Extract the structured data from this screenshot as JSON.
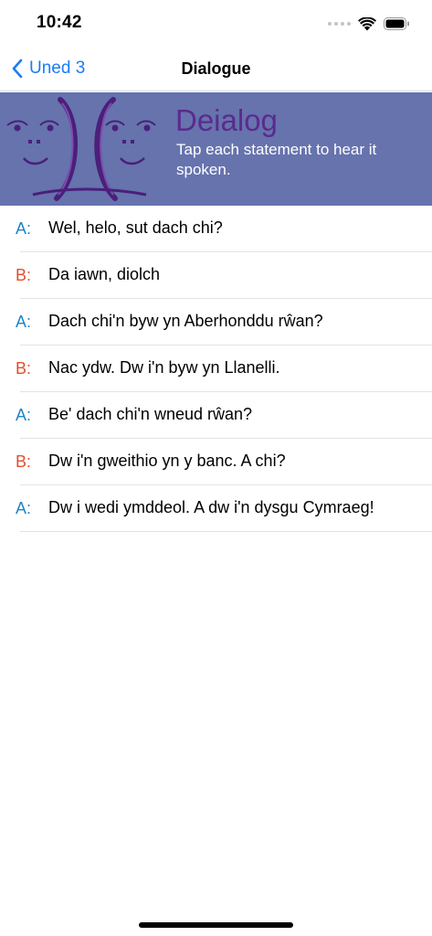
{
  "status_bar": {
    "time": "10:42"
  },
  "nav": {
    "back_label": "Uned 3",
    "title": "Dialogue"
  },
  "banner": {
    "title": "Deialog",
    "subtitle": "Tap each statement to hear it spoken."
  },
  "dialogue": [
    {
      "speaker": "A:",
      "text": "Wel, helo, sut dach chi?"
    },
    {
      "speaker": "B:",
      "text": "Da iawn, diolch"
    },
    {
      "speaker": "A:",
      "text": "Dach chi'n byw yn Aberhonddu rŵan?"
    },
    {
      "speaker": "B:",
      "text": "Nac ydw. Dw i'n byw yn Llanelli."
    },
    {
      "speaker": "A:",
      "text": "Be' dach chi'n wneud rŵan?"
    },
    {
      "speaker": "B:",
      "text": "Dw i'n gweithio yn y banc. A chi?"
    },
    {
      "speaker": "A:",
      "text": "Dw i wedi ymddeol. A dw i'n dysgu Cymraeg!"
    }
  ],
  "colors": {
    "accent_blue": "#1a7cf5",
    "speaker_a": "#1f85c7",
    "speaker_b": "#e0502e",
    "banner_bg": "#6673ad",
    "banner_title": "#5b2a8e"
  },
  "icons": {
    "back": "chevron-left-icon",
    "signal": "cellular-signal-icon",
    "wifi": "wifi-icon",
    "battery": "battery-icon",
    "banner_art": "two-faces-icon"
  }
}
